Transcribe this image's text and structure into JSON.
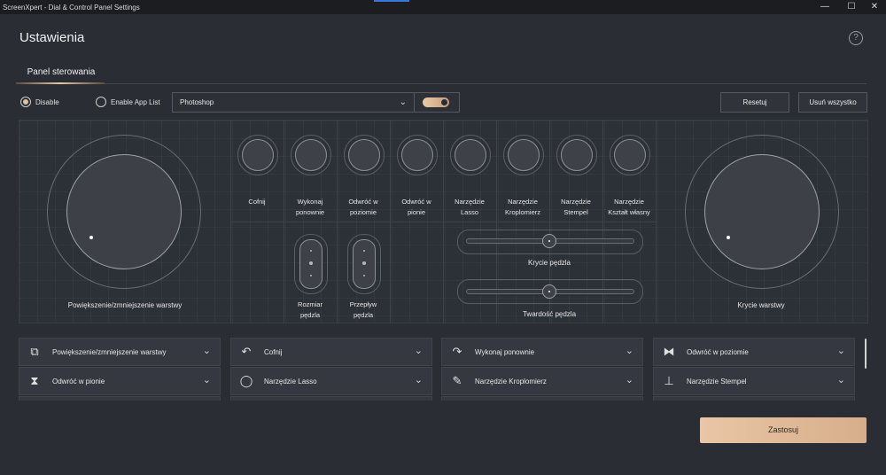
{
  "window": {
    "title": "ScreenXpert - Dial & Control Panel Settings",
    "controls": {
      "minimize": "—",
      "maximize": "☐",
      "close": "✕"
    }
  },
  "header": {
    "title": "Ustawienia",
    "help_icon": "?"
  },
  "tabs": [
    {
      "label": "Panel sterowania",
      "active": true
    }
  ],
  "options": {
    "disable_label": "Disable",
    "disable_selected": true,
    "enable_app_list_label": "Enable App List",
    "app_select_value": "Photoshop",
    "toggle_on": true,
    "reset_label": "Resetuj",
    "delete_all_label": "Usuń wszystko"
  },
  "panel": {
    "left_dial_label": "Powiększenie/zmniejszenie warstwy",
    "right_dial_label": "Krycie warstwy",
    "buttons": [
      {
        "line1": "Cofnij",
        "line2": ""
      },
      {
        "line1": "Wykonaj",
        "line2": "ponownie"
      },
      {
        "line1": "Odwróć w",
        "line2": "poziomie"
      },
      {
        "line1": "Odwróć w",
        "line2": "pionie"
      },
      {
        "line1": "Narzędzie",
        "line2": "Lasso"
      },
      {
        "line1": "Narzędzie",
        "line2": "Kroplomierz"
      },
      {
        "line1": "Narzędzie",
        "line2": "Stempel"
      },
      {
        "line1": "Narzędzie",
        "line2": "Kształt własny"
      }
    ],
    "toggles": [
      {
        "line1": "Rozmiar",
        "line2": "pędzla"
      },
      {
        "line1": "Przepływ",
        "line2": "pędzla"
      }
    ],
    "sliders": [
      {
        "label": "Krycie pędzla",
        "value": 0.5
      },
      {
        "label": "Twardość pędzla",
        "value": 0.5
      }
    ]
  },
  "assignments": [
    {
      "icon": "layers-zoom-icon",
      "glyph": "⧉",
      "label": "Powiększenie/zmniejszenie warstwy"
    },
    {
      "icon": "undo-icon",
      "glyph": "↶",
      "label": "Cofnij"
    },
    {
      "icon": "redo-icon",
      "glyph": "↷",
      "label": "Wykonaj ponownie"
    },
    {
      "icon": "flip-horizontal-icon",
      "glyph": "⧓",
      "label": "Odwróć w poziomie"
    },
    {
      "icon": "flip-vertical-icon",
      "glyph": "⧗",
      "label": "Odwróć w pionie"
    },
    {
      "icon": "lasso-icon",
      "glyph": "◯",
      "label": "Narzędzie Lasso"
    },
    {
      "icon": "eyedropper-icon",
      "glyph": "✎",
      "label": "Narzędzie Kroplomierz"
    },
    {
      "icon": "stamp-icon",
      "glyph": "⊥",
      "label": "Narzędzie Stempel"
    }
  ],
  "apply_label": "Zastosuj"
}
